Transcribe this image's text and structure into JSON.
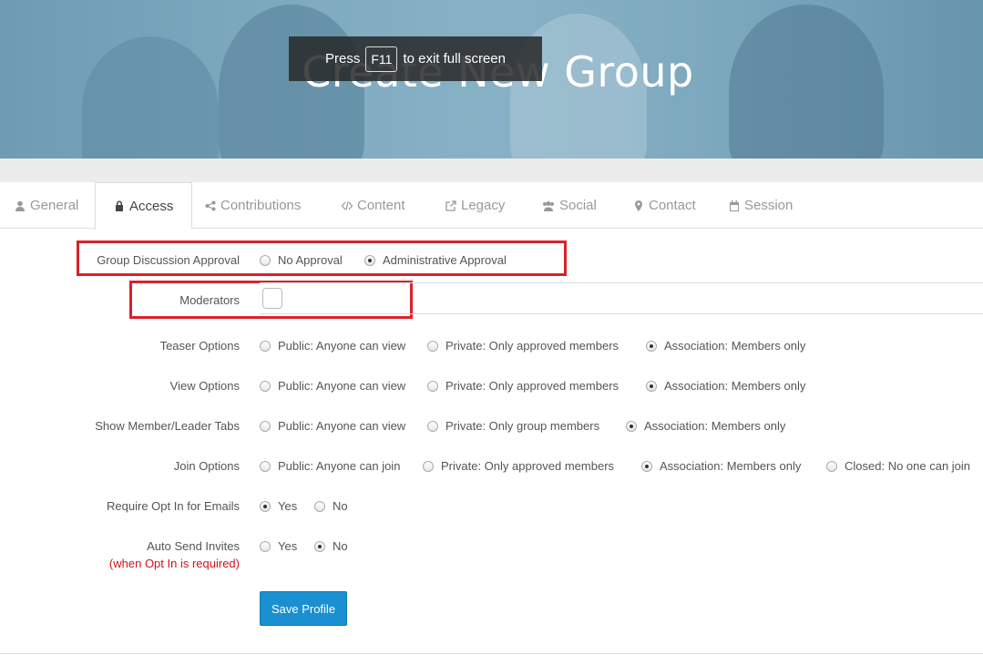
{
  "banner": {
    "title": "Create New Group",
    "fullscreen": {
      "press": "Press",
      "key": "F11",
      "suffix": "to exit full screen"
    }
  },
  "tabs": [
    {
      "label": "General",
      "icon": "user-icon",
      "active": false
    },
    {
      "label": "Access",
      "icon": "lock-icon",
      "active": true
    },
    {
      "label": "Contributions",
      "icon": "share-icon",
      "active": false
    },
    {
      "label": "Content",
      "icon": "code-icon",
      "active": false
    },
    {
      "label": "Legacy",
      "icon": "external-link-icon",
      "active": false
    },
    {
      "label": "Social",
      "icon": "users-icon",
      "active": false
    },
    {
      "label": "Contact",
      "icon": "map-marker-icon",
      "active": false
    },
    {
      "label": "Session",
      "icon": "calendar-icon",
      "active": false
    }
  ],
  "form": {
    "discussion_approval": {
      "label": "Group Discussion Approval",
      "options": [
        "No Approval",
        "Administrative Approval"
      ],
      "selected": 1
    },
    "moderators": {
      "label": "Moderators",
      "value": ""
    },
    "teaser": {
      "label": "Teaser Options",
      "options": [
        "Public: Anyone can view",
        "Private: Only approved members",
        "Association: Members only"
      ],
      "selected": 2
    },
    "view": {
      "label": "View Options",
      "options": [
        "Public: Anyone can view",
        "Private: Only approved members",
        "Association: Members only"
      ],
      "selected": 2
    },
    "tabs_visibility": {
      "label": "Show Member/Leader Tabs",
      "options": [
        "Public: Anyone can view",
        "Private: Only group members",
        "Association: Members only"
      ],
      "selected": 2
    },
    "join": {
      "label": "Join Options",
      "options": [
        "Public: Anyone can join",
        "Private: Only approved members",
        "Association: Members only",
        "Closed: No one can join"
      ],
      "selected": 2
    },
    "opt_in": {
      "label": "Require Opt In for Emails",
      "options": [
        "Yes",
        "No"
      ],
      "selected": 0
    },
    "auto_invites": {
      "label": "Auto Send Invites",
      "note": "(when Opt In is required)",
      "options": [
        "Yes",
        "No"
      ],
      "selected": 1
    },
    "save_label": "Save Profile"
  },
  "colors": {
    "accent": "#1a8fd2",
    "highlight": "#d9222a",
    "note": "#d0121b"
  }
}
